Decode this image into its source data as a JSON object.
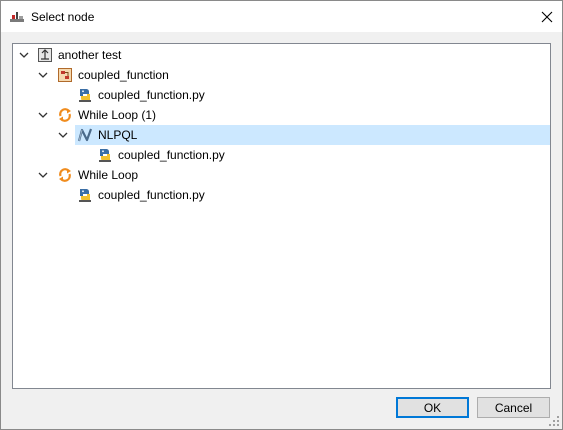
{
  "window": {
    "title": "Select node"
  },
  "tree": {
    "items": [
      {
        "label": "another test",
        "icon": "project-icon"
      },
      {
        "label": "coupled_function",
        "icon": "function-block-icon"
      },
      {
        "label": "coupled_function.py",
        "icon": "python-file-icon"
      },
      {
        "label": "While Loop (1)",
        "icon": "loop-icon"
      },
      {
        "label": "NLPQL",
        "icon": "optimizer-icon"
      },
      {
        "label": "coupled_function.py",
        "icon": "python-file-icon"
      },
      {
        "label": "While Loop",
        "icon": "loop-icon"
      },
      {
        "label": "coupled_function.py",
        "icon": "python-file-icon"
      }
    ],
    "selected_index": 4
  },
  "buttons": {
    "ok_label": "OK",
    "cancel_label": "Cancel"
  },
  "colors": {
    "selection": "#cce8ff",
    "accent": "#0078d7",
    "loop": "#f08c1e"
  }
}
